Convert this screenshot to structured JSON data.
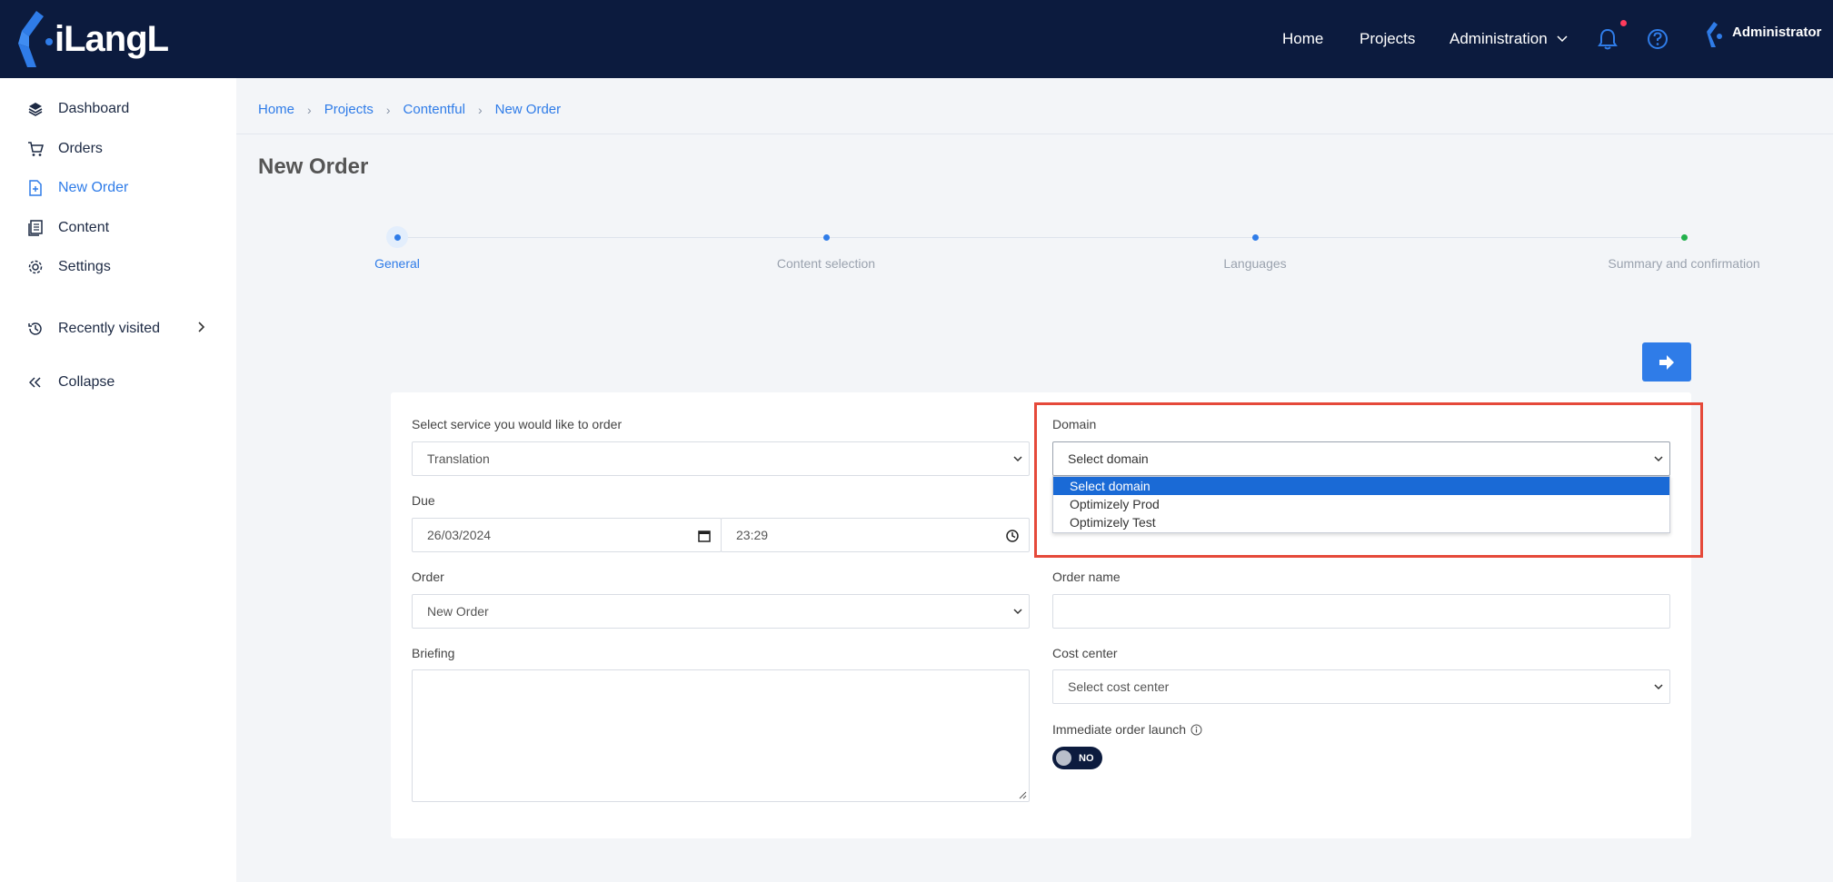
{
  "app": {
    "logo_text": "iLangL"
  },
  "topnav": {
    "home": "Home",
    "projects": "Projects",
    "administration": "Administration",
    "user": "Administrator"
  },
  "sidebar": {
    "items": [
      {
        "label": "Dashboard",
        "icon": "layers-icon"
      },
      {
        "label": "Orders",
        "icon": "cart-icon"
      },
      {
        "label": "New Order",
        "icon": "new-file-icon",
        "active": true
      },
      {
        "label": "Content",
        "icon": "documents-icon"
      },
      {
        "label": "Settings",
        "icon": "gear-icon"
      },
      {
        "label": "Recently visited",
        "icon": "history-icon"
      },
      {
        "label": "Collapse",
        "icon": "double-chevron-left-icon"
      }
    ]
  },
  "breadcrumb": [
    "Home",
    "Projects",
    "Contentful",
    "New Order"
  ],
  "page": {
    "title": "New Order"
  },
  "stepper": {
    "steps": [
      {
        "label": "General",
        "active": true,
        "color": "#2f7ce8"
      },
      {
        "label": "Content selection",
        "color": "#2f7ce8"
      },
      {
        "label": "Languages",
        "color": "#2f7ce8"
      },
      {
        "label": "Summary and confirmation",
        "color": "#22b14c"
      }
    ]
  },
  "form": {
    "service_label": "Select service you would like to order",
    "service_value": "Translation",
    "due_label": "Due",
    "due_date": "26/03/2024",
    "due_time": "23:29",
    "order_label": "Order",
    "order_value": "New Order",
    "briefing_label": "Briefing",
    "domain_label": "Domain",
    "domain_value": "Select domain",
    "domain_options": [
      "Select domain",
      "Optimizely Prod",
      "Optimizely Test"
    ],
    "order_name_label": "Order name",
    "order_name_value": "",
    "cost_center_label": "Cost center",
    "cost_center_value": "Select cost center",
    "immediate_label": "Immediate order launch",
    "immediate_toggle": "NO"
  },
  "colors": {
    "topbar": "#0c1b3e",
    "accent": "#2f7ce8",
    "highlight": "#e5493a",
    "notification_dot": "#ff3b5c"
  }
}
